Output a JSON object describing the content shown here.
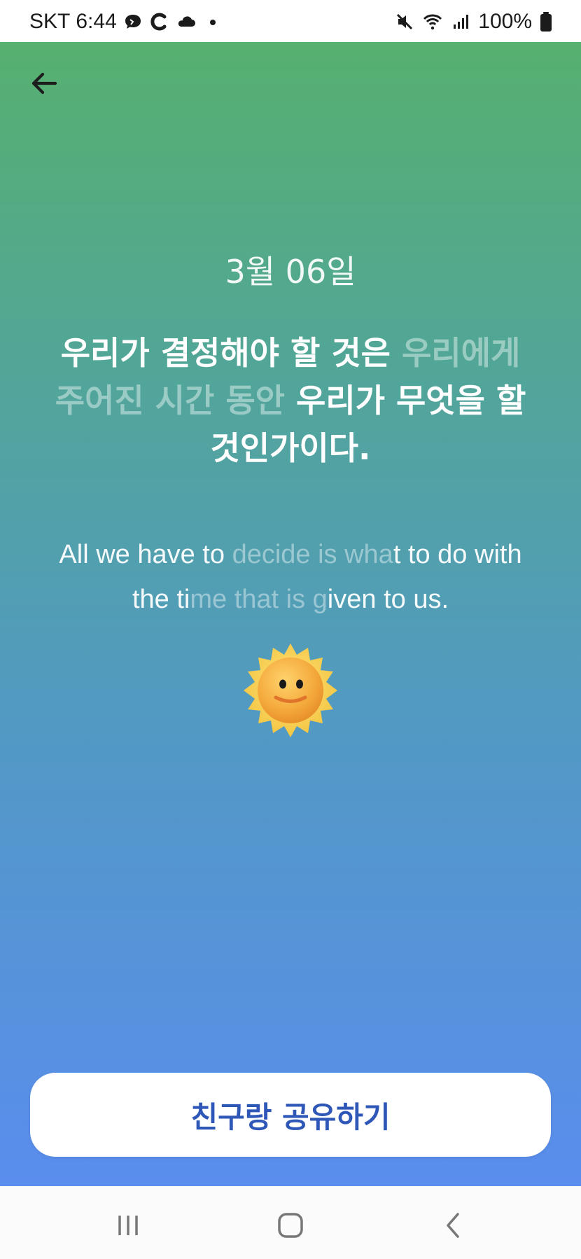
{
  "status_bar": {
    "carrier": "SKT",
    "time": "6:44",
    "battery": "100%"
  },
  "header": {
    "back_icon": "arrow-left-icon"
  },
  "content": {
    "date": "3월 06일",
    "quote_ko": [
      {
        "text": "우리가 결정해야 할 것은 ",
        "dim": false
      },
      {
        "text": "우리에게 주어진 시간 동안",
        "dim": true
      },
      {
        "text": " 우리가 무엇을 할 것인가이다.",
        "dim": false
      }
    ],
    "quote_en": [
      {
        "text": "All we have to ",
        "dim": false
      },
      {
        "text": "decide is wha",
        "dim": true
      },
      {
        "text": "t to do with the ti",
        "dim": false
      },
      {
        "text": "me that is g",
        "dim": true
      },
      {
        "text": "iven to us.",
        "dim": false
      }
    ],
    "emoji": "sun-face-icon"
  },
  "actions": {
    "share_label": "친구랑 공유하기"
  },
  "colors": {
    "gradient_top": "#56b06f",
    "gradient_bottom": "#5a8dee",
    "share_text": "#2e57b8"
  },
  "nav_bar": {
    "recents_icon": "recents-icon",
    "home_icon": "home-icon",
    "back_icon": "chevron-left-icon"
  }
}
